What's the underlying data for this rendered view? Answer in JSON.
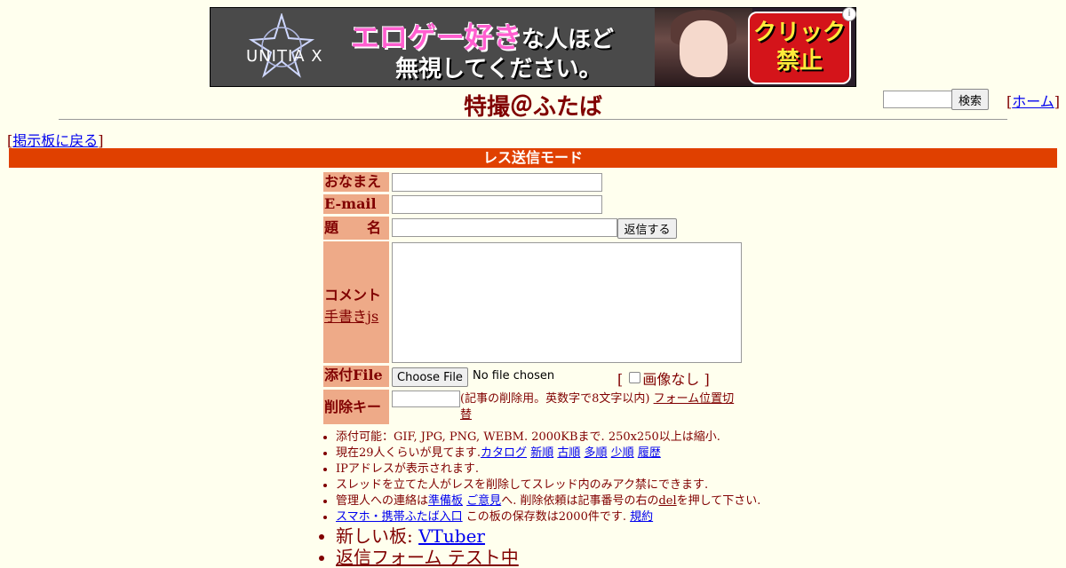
{
  "ad": {
    "logo_text": "UNITIA X",
    "headline_pink": "エロゲー好き",
    "headline_white": "な人ほど",
    "headline2": "無視してください。",
    "cta_line1": "クリック",
    "cta_line2": "禁止",
    "info_symbol": "i"
  },
  "header": {
    "board_title": "特撮＠ふたば",
    "search_button": "検索",
    "home_open": "[",
    "home_label": "ホーム",
    "home_close": "]"
  },
  "nav": {
    "back_open": "[",
    "back_label": "掲示板に戻る",
    "back_close": "]"
  },
  "mode_bar": "レス送信モード",
  "form": {
    "name_label": "おなまえ",
    "email_label": "E-mail",
    "subject_label": "題　　名",
    "reply_button": "返信する",
    "comment_label": "コメント",
    "handwrite_link": "手書きjs",
    "file_label": "添付File",
    "file_button": "Choose File",
    "file_status": "No file chosen",
    "noimg_open": "[",
    "noimg_label": "画像なし",
    "noimg_close": "]",
    "delkey_label": "削除キー",
    "delkey_note": "(記事の削除用。英数字で8文字以内)",
    "form_pos_link": "フォーム位置切替"
  },
  "notes": {
    "line1": "添付可能：GIF, JPG, PNG, WEBM. 2000KBまで. 250x250以上は縮小.",
    "line2_prefix": "現在29人くらいが見てます.",
    "line2_links": [
      "カタログ",
      "新順",
      "古順",
      "多順",
      "少順",
      "履歴"
    ],
    "line3": "IPアドレスが表示されます.",
    "line4": "スレッドを立てた人がレスを削除してスレッド内のみアク禁にできます.",
    "line5_prefix": "管理人への連絡は",
    "line5_link1": "準備板",
    "line5_link2": "ご意見",
    "line5_mid": "へ. 削除依頼は記事番号の右の",
    "line5_del": "del",
    "line5_suffix": "を押して下さい.",
    "line6_link": "スマホ・携帯ふたば入口",
    "line6_mid": " この板の保存数は2000件です. ",
    "line6_rules": "規約",
    "line7_prefix": "新しい板: ",
    "line7_link": "VTuber",
    "line8_link": "返信フォーム テスト中"
  }
}
